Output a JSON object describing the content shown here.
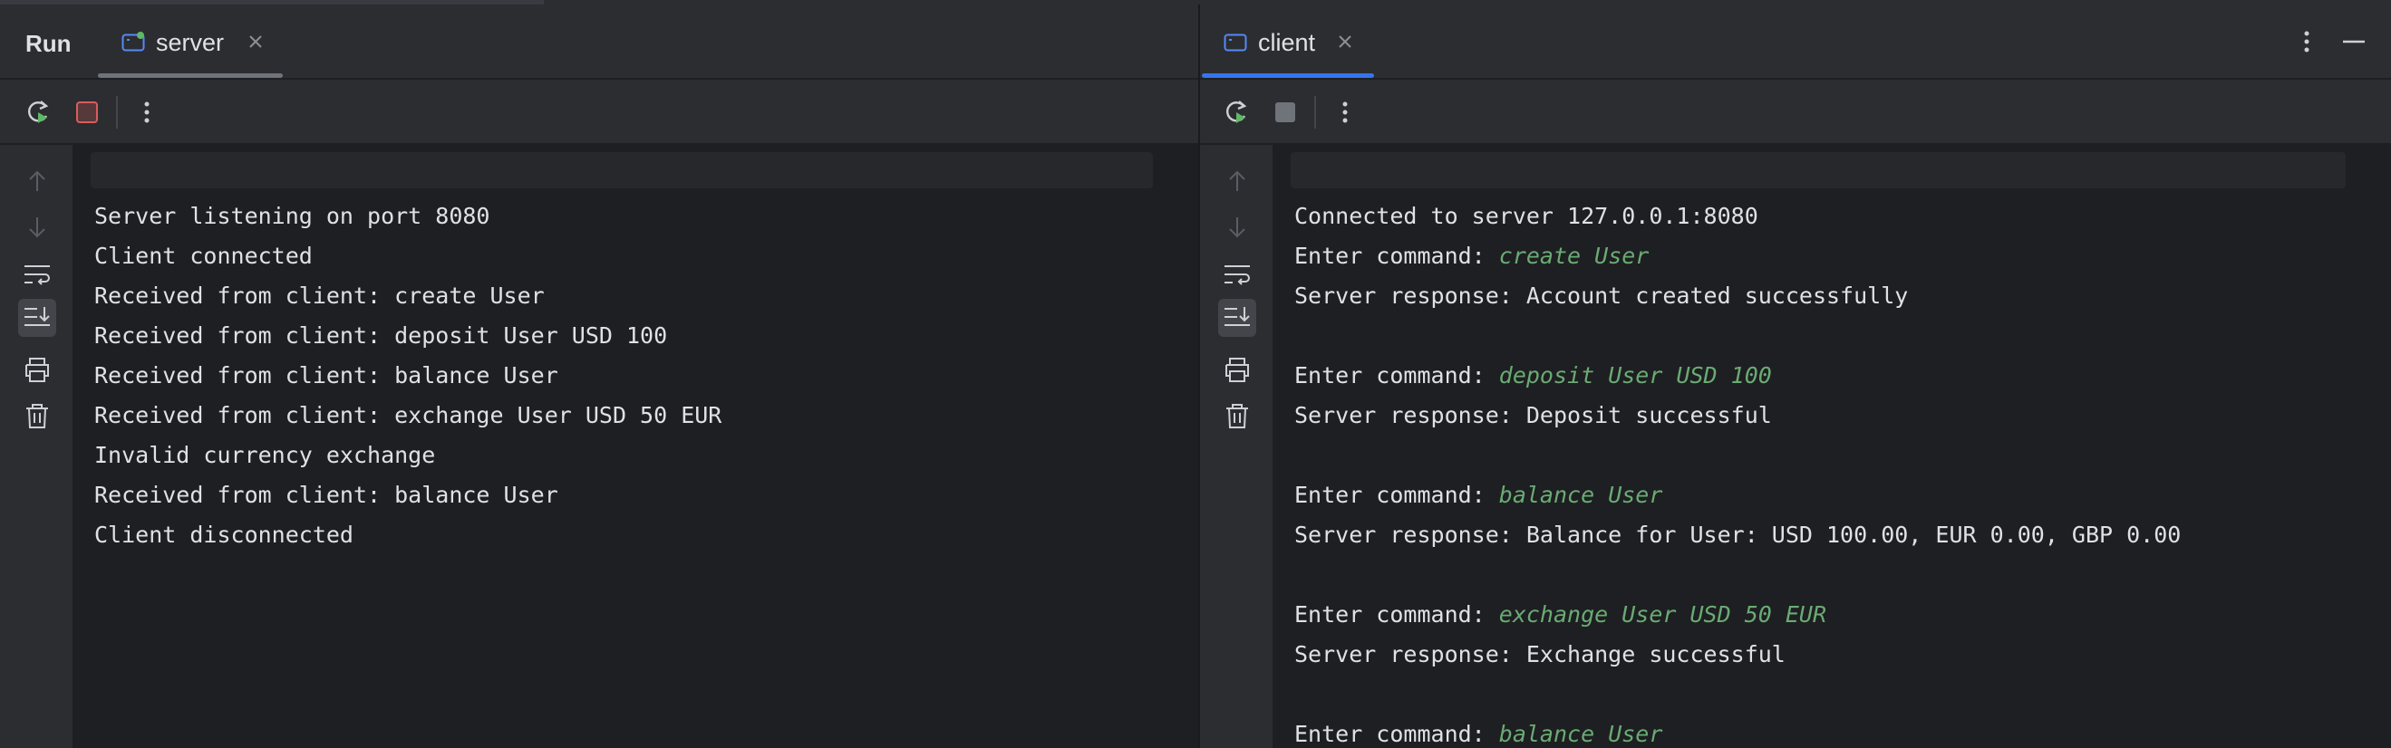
{
  "run_label": "Run",
  "colors": {
    "background": "#1e1f22",
    "panel": "#2b2d30",
    "text": "#dfe1e5",
    "user_input": "#6aab73",
    "tab_underline_active": "#3574f0",
    "stop_active": "#db5c5c",
    "rerun_green": "#5fb865"
  },
  "server": {
    "tab_label": "server",
    "icons": {
      "tab": "console-icon",
      "close": "close-icon",
      "rerun": "rerun-icon",
      "stop": "stop-icon",
      "more": "more-vertical-icon"
    },
    "lines": [
      {
        "text": "Server listening on port 8080"
      },
      {
        "text": "Client connected"
      },
      {
        "text": "Received from client: create User"
      },
      {
        "text": "Received from client: deposit User USD 100"
      },
      {
        "text": "Received from client: balance User"
      },
      {
        "text": "Received from client: exchange User USD 50 EUR"
      },
      {
        "text": "Invalid currency exchange"
      },
      {
        "text": "Received from client: balance User"
      },
      {
        "text": "Client disconnected"
      }
    ]
  },
  "client": {
    "tab_label": "client",
    "icons": {
      "tab": "console-icon",
      "close": "close-icon",
      "rerun": "rerun-icon",
      "stop": "stop-icon",
      "more": "more-vertical-icon",
      "options": "more-vertical-icon",
      "minimize": "minimize-icon"
    },
    "lines": [
      {
        "text": "Connected to server 127.0.0.1:8080"
      },
      {
        "prompt": "Enter command: ",
        "input": "create User"
      },
      {
        "text": "Server response: Account created successfully"
      },
      {
        "text": ""
      },
      {
        "prompt": "Enter command: ",
        "input": "deposit User USD 100"
      },
      {
        "text": "Server response: Deposit successful"
      },
      {
        "text": ""
      },
      {
        "prompt": "Enter command: ",
        "input": "balance User"
      },
      {
        "text": "Server response: Balance for User: USD 100.00, EUR 0.00, GBP 0.00"
      },
      {
        "text": ""
      },
      {
        "prompt": "Enter command: ",
        "input": "exchange User USD 50 EUR"
      },
      {
        "text": "Server response: Exchange successful"
      },
      {
        "text": ""
      },
      {
        "prompt": "Enter command: ",
        "input": "balance User"
      }
    ]
  },
  "gutter_icons": [
    "arrow-up-icon",
    "arrow-down-icon",
    "soft-wrap-icon",
    "scroll-to-end-icon",
    "print-icon",
    "trash-icon"
  ]
}
